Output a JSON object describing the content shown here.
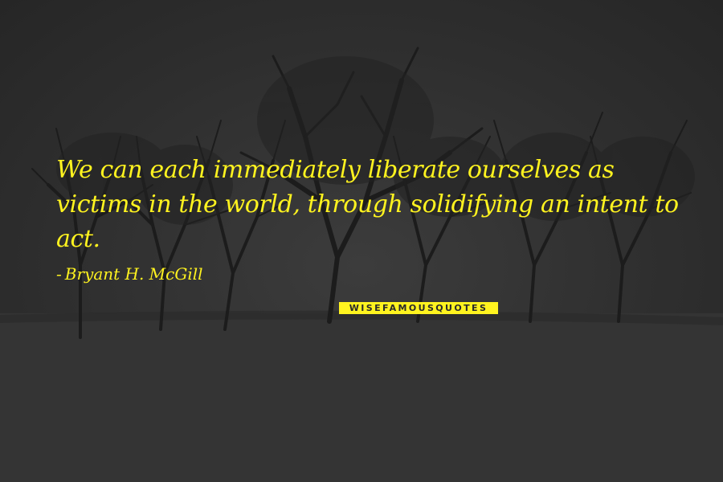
{
  "quote": {
    "text": "We can each immediately liberate ourselves as victims in the world, through solidifying an intent to act.",
    "dash": "-",
    "author": "Bryant H. McGill"
  },
  "watermark": {
    "text": "WISEFAMOUSQUOTES"
  },
  "colors": {
    "text": "#fff31f",
    "background": "#2f2f2f"
  }
}
